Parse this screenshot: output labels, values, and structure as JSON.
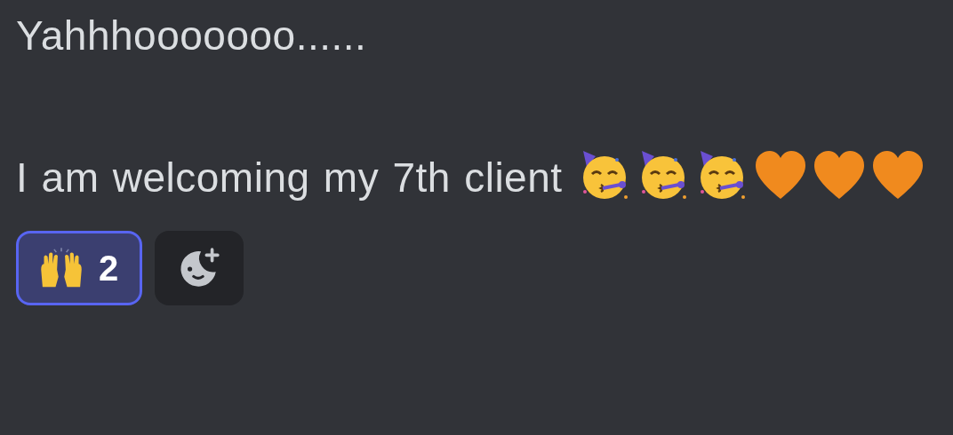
{
  "message": {
    "paragraphs": [
      {
        "text": "Yahhhooooooo......"
      },
      {
        "text": "I am welcoming my 7th client",
        "emojis": [
          {
            "kind": "partying-face"
          },
          {
            "kind": "partying-face"
          },
          {
            "kind": "partying-face"
          },
          {
            "kind": "orange-heart"
          },
          {
            "kind": "orange-heart"
          },
          {
            "kind": "orange-heart"
          }
        ]
      }
    ]
  },
  "reactions": [
    {
      "kind": "raised-hands",
      "count": "2",
      "selected": true
    }
  ],
  "add_reaction": {
    "kind": "add-reaction"
  }
}
